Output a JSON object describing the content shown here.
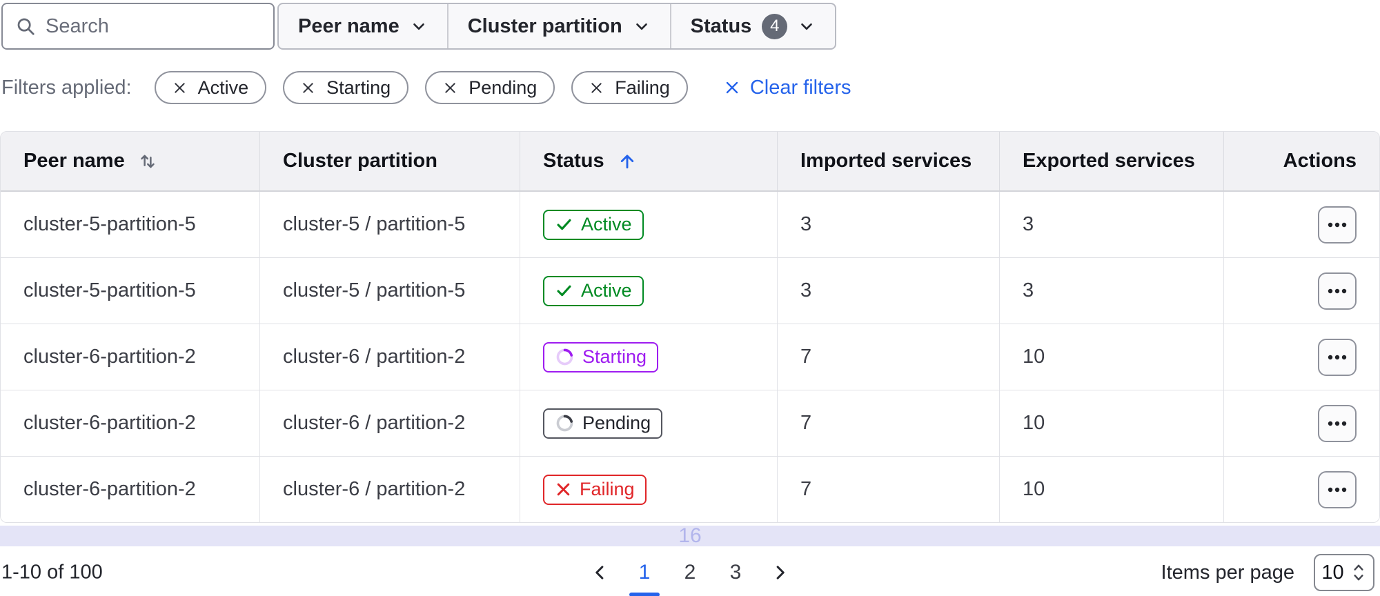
{
  "toolbar": {
    "search_placeholder": "Search",
    "dropdowns": [
      {
        "label": "Peer name"
      },
      {
        "label": "Cluster partition"
      },
      {
        "label": "Status",
        "count": "4"
      }
    ]
  },
  "filters": {
    "label": "Filters applied:",
    "chips": [
      "Active",
      "Starting",
      "Pending",
      "Failing"
    ],
    "clear_label": "Clear filters"
  },
  "table": {
    "columns": [
      "Peer name",
      "Cluster partition",
      "Status",
      "Imported services",
      "Exported services",
      "Actions"
    ],
    "sort": {
      "peer_name": "unsorted-both-arrows",
      "status": "ascending"
    },
    "rows": [
      {
        "peer_name": "cluster-5-partition-5",
        "cluster_partition": "cluster-5 / partition-5",
        "status": {
          "label": "Active",
          "variant": "active"
        },
        "imported": "3",
        "exported": "3"
      },
      {
        "peer_name": "cluster-5-partition-5",
        "cluster_partition": "cluster-5 / partition-5",
        "status": {
          "label": "Active",
          "variant": "active"
        },
        "imported": "3",
        "exported": "3"
      },
      {
        "peer_name": "cluster-6-partition-2",
        "cluster_partition": "cluster-6 / partition-2",
        "status": {
          "label": "Starting",
          "variant": "starting"
        },
        "imported": "7",
        "exported": "10"
      },
      {
        "peer_name": "cluster-6-partition-2",
        "cluster_partition": "cluster-6 / partition-2",
        "status": {
          "label": "Pending",
          "variant": "pending"
        },
        "imported": "7",
        "exported": "10"
      },
      {
        "peer_name": "cluster-6-partition-2",
        "cluster_partition": "cluster-6 / partition-2",
        "status": {
          "label": "Failing",
          "variant": "failing"
        },
        "imported": "7",
        "exported": "10"
      }
    ],
    "overflow_row_text": "16"
  },
  "pagination": {
    "range_label": "1-10 of 100",
    "pages": [
      "1",
      "2",
      "3"
    ],
    "current_page": "1",
    "items_per_page_label": "Items per page",
    "items_per_page_value": "10"
  },
  "icons": {
    "search": "magnifier",
    "dropdown_caret": "chevron-down",
    "chip_dismiss": "x",
    "sort_unsorted": "arrow-up-arrow-down",
    "sort_ascending": "arrow-up",
    "status_active": "check",
    "status_loading": "spinner-ring",
    "status_failing": "x",
    "row_actions": "ellipsis-horizontal",
    "pager_prev": "chevron-left",
    "pager_next": "chevron-right",
    "per_page_stepper": "chevrons-up-down"
  },
  "colors": {
    "accent_blue": "#2563eb",
    "success_green": "#008a22",
    "purple": "#9e1cf0",
    "critical_red": "#e02528",
    "neutral_text": "#3b3d45",
    "header_bg": "#f1f1f4",
    "lavender_bg": "#e4e4f7",
    "lavender_text": "#b2b5ec",
    "badge_count_bg": "#656a76"
  }
}
